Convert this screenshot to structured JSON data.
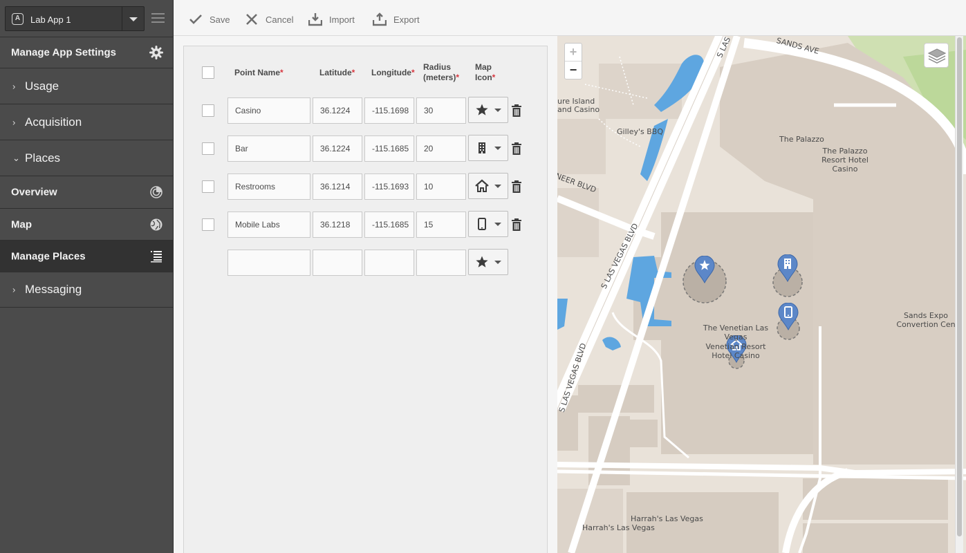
{
  "app": {
    "name": "Lab App 1",
    "logo_letter": "A"
  },
  "sidebar": {
    "settings_label": "Manage App Settings",
    "items": [
      {
        "label": "Usage",
        "chevron": "›"
      },
      {
        "label": "Acquisition",
        "chevron": "›"
      },
      {
        "label": "Places",
        "chevron": "⌄"
      },
      {
        "label": "Overview"
      },
      {
        "label": "Map"
      },
      {
        "label": "Manage Places",
        "selected": true
      },
      {
        "label": "Messaging",
        "chevron": "›"
      }
    ]
  },
  "toolbar": {
    "save_label": "Save",
    "cancel_label": "Cancel",
    "import_label": "Import",
    "export_label": "Export"
  },
  "table": {
    "headers": {
      "point_name": "Point Name",
      "latitude": "Latitude",
      "longitude": "Longitude",
      "radius_line1": "Radius",
      "radius_line2": "(meters)",
      "icon_line1": "Map",
      "icon_line2": "Icon",
      "required_mark": "*"
    },
    "rows": [
      {
        "name": "Casino",
        "latitude": "36.1224",
        "longitude": "-115.1698",
        "radius": "30",
        "icon": "star-icon"
      },
      {
        "name": "Bar",
        "latitude": "36.1224",
        "longitude": "-115.1685",
        "radius": "20",
        "icon": "building-icon"
      },
      {
        "name": "Restrooms",
        "latitude": "36.1214",
        "longitude": "-115.1693",
        "radius": "10",
        "icon": "home-icon"
      },
      {
        "name": "Mobile Labs",
        "latitude": "36.1218",
        "longitude": "-115.1685",
        "radius": "15",
        "icon": "phone-icon"
      }
    ],
    "new_row": {
      "name": "",
      "latitude": "",
      "longitude": "",
      "radius": "",
      "icon": "star-icon"
    }
  },
  "map": {
    "zoom_in": "+",
    "zoom_out": "−",
    "labels": {
      "sands_ave": "SANDS AVE",
      "s_las_top": "S LAS",
      "treasure_island_1": "ure Island",
      "treasure_island_2": "and Casino",
      "gilleys": "Gilley's BBQ",
      "palazzo": "The Palazzo",
      "palazzo_resort_1": "The Palazzo",
      "palazzo_resort_2": "Resort Hotel",
      "palazzo_resort_3": "Casino",
      "spring_mountain": "NEER BLVD",
      "s_las_vegas_mid": "S LAS VEGAS BLVD",
      "s_las_vegas_bottom": "S LAS VEGAS BLVD",
      "venetian_1": "The Venetian Las",
      "venetian_2": "Vegas",
      "venetian_3": "Venetian Resort",
      "venetian_4": "Hotel Casino",
      "sands_expo_1": "Sands Expo",
      "sands_expo_2": "Convertion Cen",
      "harrahs_1": "Harrah's Las Vegas",
      "harrahs_2": "Harrah's Las Vegas"
    }
  },
  "colors": {
    "sidebar_bg": "#4b4b4b",
    "sidebar_selected": "#323232",
    "required": "#d7373f",
    "marker": "#5c87c8",
    "water": "#5ea6e0",
    "map_land": "#e9e2d9",
    "building": "#d7cec3"
  }
}
